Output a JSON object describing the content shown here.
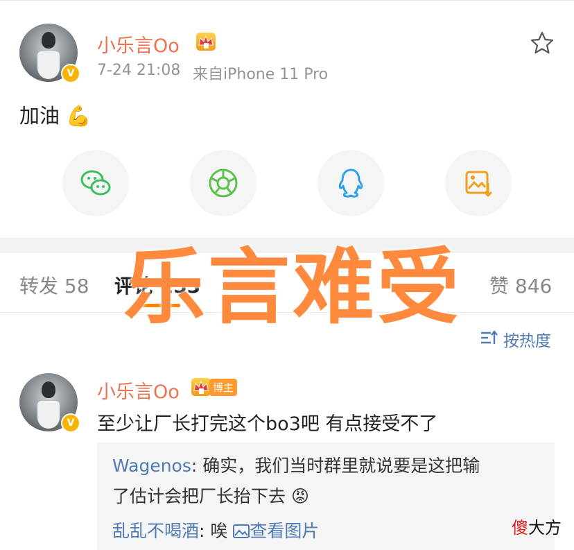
{
  "post": {
    "username": "小乐言Oo",
    "timestamp": "7-24 21:08",
    "source": "来自iPhone 11 Pro",
    "text": "加油 💪",
    "verified_badge": "V"
  },
  "share_buttons": [
    {
      "icon": "wechat-icon",
      "color": "#3bbf5c"
    },
    {
      "icon": "moments-icon",
      "color": "#5bc34a"
    },
    {
      "icon": "qq-icon",
      "color": "#2ca0e8"
    },
    {
      "icon": "save-image-icon",
      "color": "#f0a020"
    }
  ],
  "overlay_caption": "乐言难受",
  "tabs": {
    "repost": "转发 58",
    "comments": "评论 253",
    "likes": "赞 846"
  },
  "sort": {
    "label": "按热度"
  },
  "comment": {
    "username": "小乐言Oo",
    "badge": "博主",
    "text": "至少让厂长打完这个bo3吧 有点接受不了",
    "replies": [
      {
        "user": "Wagenos",
        "sep": ": ",
        "text_line1": "确实，我们当时群里就说要是这把输",
        "text_line2": "了估计会把厂长抬下去 😡"
      },
      {
        "user": "乱乱不喝酒",
        "sep": ": ",
        "text": "唉 ",
        "link": "查看图片"
      }
    ]
  },
  "watermark": {
    "red_char": "傻",
    "rest": "大方"
  },
  "colors": {
    "username": "#eb7350",
    "link_blue": "#4f7bb5",
    "accent_orange": "#ff8200",
    "overlay_orange": "#ff8a3d"
  }
}
